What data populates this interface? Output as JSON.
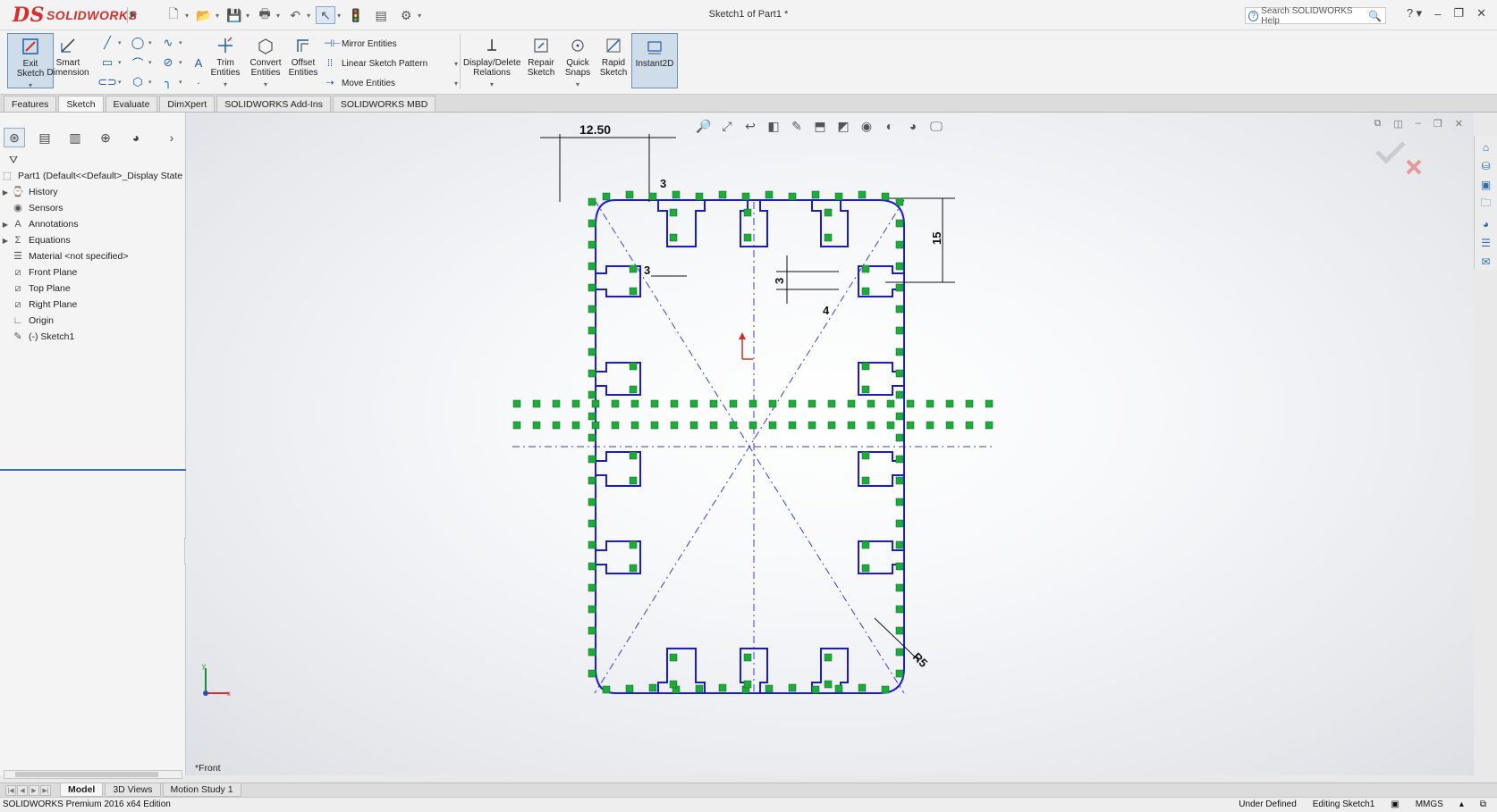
{
  "app": {
    "brand": "SOLIDWORKS",
    "brand_prefix": "DS",
    "document_title": "Sketch1 of Part1 *",
    "help_search_placeholder": "Search SOLIDWORKS Help"
  },
  "command_manager": {
    "exit_sketch": "Exit Sketch",
    "smart_dimension": "Smart Dimension",
    "trim_entities": "Trim Entities",
    "convert_entities": "Convert Entities",
    "offset_entities": "Offset Entities",
    "mirror_entities": "Mirror Entities",
    "linear_sketch_pattern": "Linear Sketch Pattern",
    "move_entities": "Move Entities",
    "display_delete_relations": "Display/Delete Relations",
    "repair_sketch": "Repair Sketch",
    "quick_snaps": "Quick Snaps",
    "rapid_sketch": "Rapid Sketch",
    "instant2d": "Instant2D"
  },
  "tabs": [
    "Features",
    "Sketch",
    "Evaluate",
    "DimXpert",
    "SOLIDWORKS Add-Ins",
    "SOLIDWORKS MBD"
  ],
  "active_tab": "Sketch",
  "feature_tree": {
    "root": "Part1  (Default<<Default>_Display State",
    "items": [
      {
        "label": "History",
        "expandable": true,
        "icon": "history-icon"
      },
      {
        "label": "Sensors",
        "expandable": false,
        "icon": "sensor-icon"
      },
      {
        "label": "Annotations",
        "expandable": true,
        "icon": "annotation-icon"
      },
      {
        "label": "Equations",
        "expandable": true,
        "icon": "equation-icon"
      },
      {
        "label": "Material <not specified>",
        "expandable": false,
        "icon": "material-icon"
      },
      {
        "label": "Front Plane",
        "expandable": false,
        "icon": "plane-icon"
      },
      {
        "label": "Top Plane",
        "expandable": false,
        "icon": "plane-icon"
      },
      {
        "label": "Right Plane",
        "expandable": false,
        "icon": "plane-icon"
      },
      {
        "label": "Origin",
        "expandable": false,
        "icon": "origin-icon"
      },
      {
        "label": "(-) Sketch1",
        "expandable": false,
        "icon": "sketch-icon"
      }
    ]
  },
  "graphics": {
    "view_label": "*Front",
    "dimensions": {
      "top_width": "12.50",
      "small_a": "3",
      "small_b": "3",
      "right_height": "15",
      "left_3": "3",
      "notch_4": "4",
      "radius": "R5"
    },
    "colors": {
      "sketch_line": "#1a1ad6",
      "relation_box": "#1faa3a",
      "dimension": "#111111",
      "centerline": "#3b3bd8"
    }
  },
  "bottom_tabs": [
    "Model",
    "3D Views",
    "Motion Study 1"
  ],
  "active_bottom_tab": "Model",
  "status": {
    "edition": "SOLIDWORKS Premium 2016 x64 Edition",
    "sketch_state": "Under Defined",
    "editing": "Editing Sketch1",
    "units": "MMGS"
  }
}
